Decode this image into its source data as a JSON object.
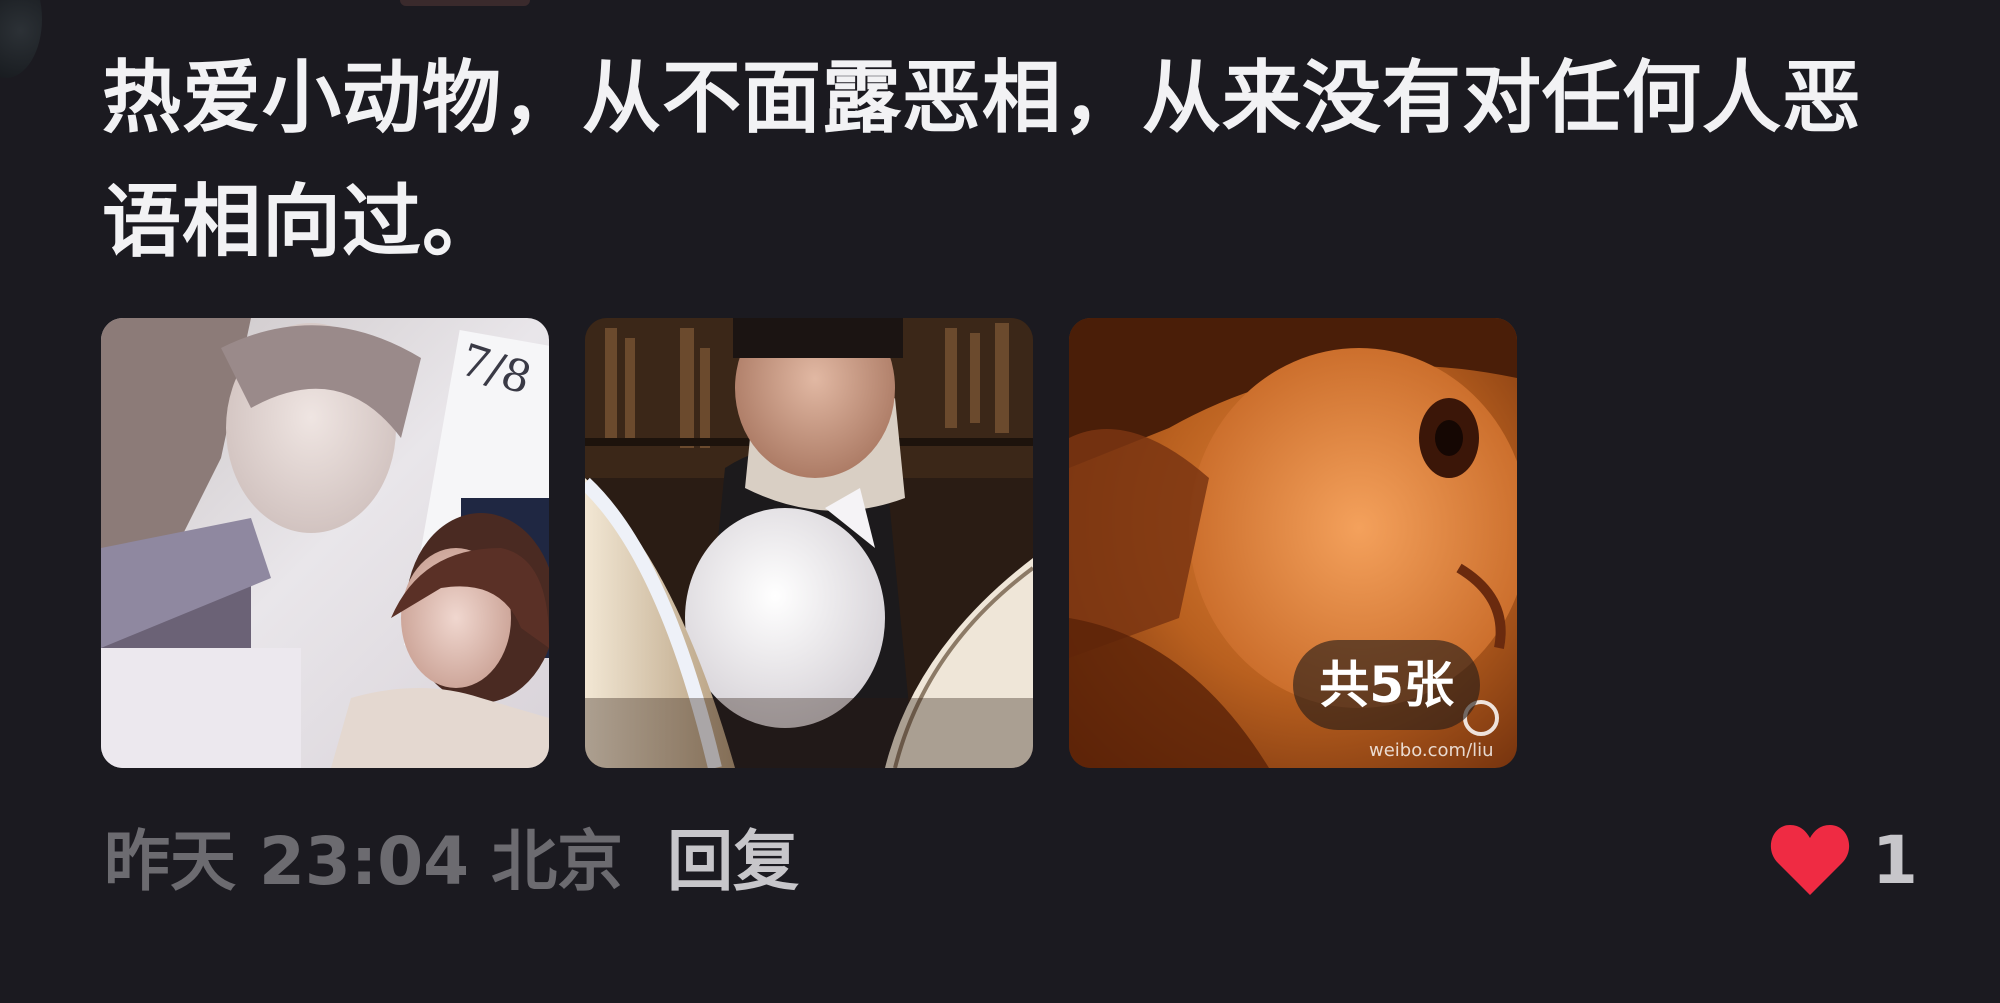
{
  "comment": {
    "text": "热爱小动物，从不面露恶相，从来没有对任何人恶语相向过。",
    "images": [
      {
        "label": "photo-1"
      },
      {
        "label": "photo-2"
      },
      {
        "label": "photo-3",
        "badge": "共5张",
        "watermark": "weibo.com/liu"
      }
    ]
  },
  "meta": {
    "time": "昨天 23:04",
    "location": "北京",
    "reply_label": "回复"
  },
  "likes": {
    "count": "1",
    "icon": "heart-icon",
    "color": "#ef2b43"
  }
}
